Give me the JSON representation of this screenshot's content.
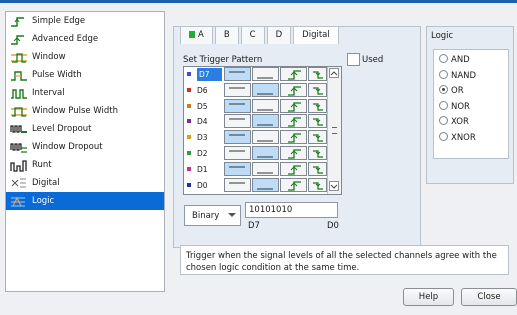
{
  "trigger_types": [
    {
      "label": "Simple Edge",
      "icon": "simple-edge-icon"
    },
    {
      "label": "Advanced Edge",
      "icon": "advanced-edge-icon"
    },
    {
      "label": "Window",
      "icon": "window-icon"
    },
    {
      "label": "Pulse Width",
      "icon": "pulse-width-icon"
    },
    {
      "label": "Interval",
      "icon": "interval-icon"
    },
    {
      "label": "Window Pulse Width",
      "icon": "window-pulse-width-icon"
    },
    {
      "label": "Level Dropout",
      "icon": "level-dropout-icon"
    },
    {
      "label": "Window Dropout",
      "icon": "window-dropout-icon"
    },
    {
      "label": "Runt",
      "icon": "runt-icon"
    },
    {
      "label": "Digital",
      "icon": "digital-icon"
    },
    {
      "label": "Logic",
      "icon": "logic-icon"
    }
  ],
  "selected_trigger": "Logic",
  "tabs": [
    "A",
    "B",
    "C",
    "D",
    "Digital"
  ],
  "active_tab": "Digital",
  "pattern_label": "Set Trigger Pattern",
  "used_label": "Used",
  "used_checked": false,
  "channels": [
    {
      "name": "D7",
      "color": "#4a4ad6",
      "selected": true,
      "level_high": true
    },
    {
      "name": "D6",
      "color": "#cc2f2f",
      "selected": false,
      "level_high": false
    },
    {
      "name": "D5",
      "color": "#d07a1e",
      "selected": false,
      "level_high": true
    },
    {
      "name": "D4",
      "color": "#7a2f9c",
      "selected": false,
      "level_high": false
    },
    {
      "name": "D3",
      "color": "#c9a812",
      "selected": false,
      "level_high": true
    },
    {
      "name": "D2",
      "color": "#2f9c45",
      "selected": false,
      "level_high": false
    },
    {
      "name": "D1",
      "color": "#d22f8a",
      "selected": false,
      "level_high": true
    },
    {
      "name": "D0",
      "color": "#2030a0",
      "selected": false,
      "level_high": false
    }
  ],
  "format_select": "Binary",
  "pattern_value": "10101010",
  "bit_msb": "D7",
  "bit_lsb": "D0",
  "logic_title": "Logic",
  "logic_options": [
    "AND",
    "NAND",
    "OR",
    "NOR",
    "XOR",
    "XNOR"
  ],
  "logic_selected": "OR",
  "description": "Trigger when the signal levels of all the selected channels agree with the chosen logic condition at the same time.",
  "help_label": "Help",
  "close_label": "Close"
}
